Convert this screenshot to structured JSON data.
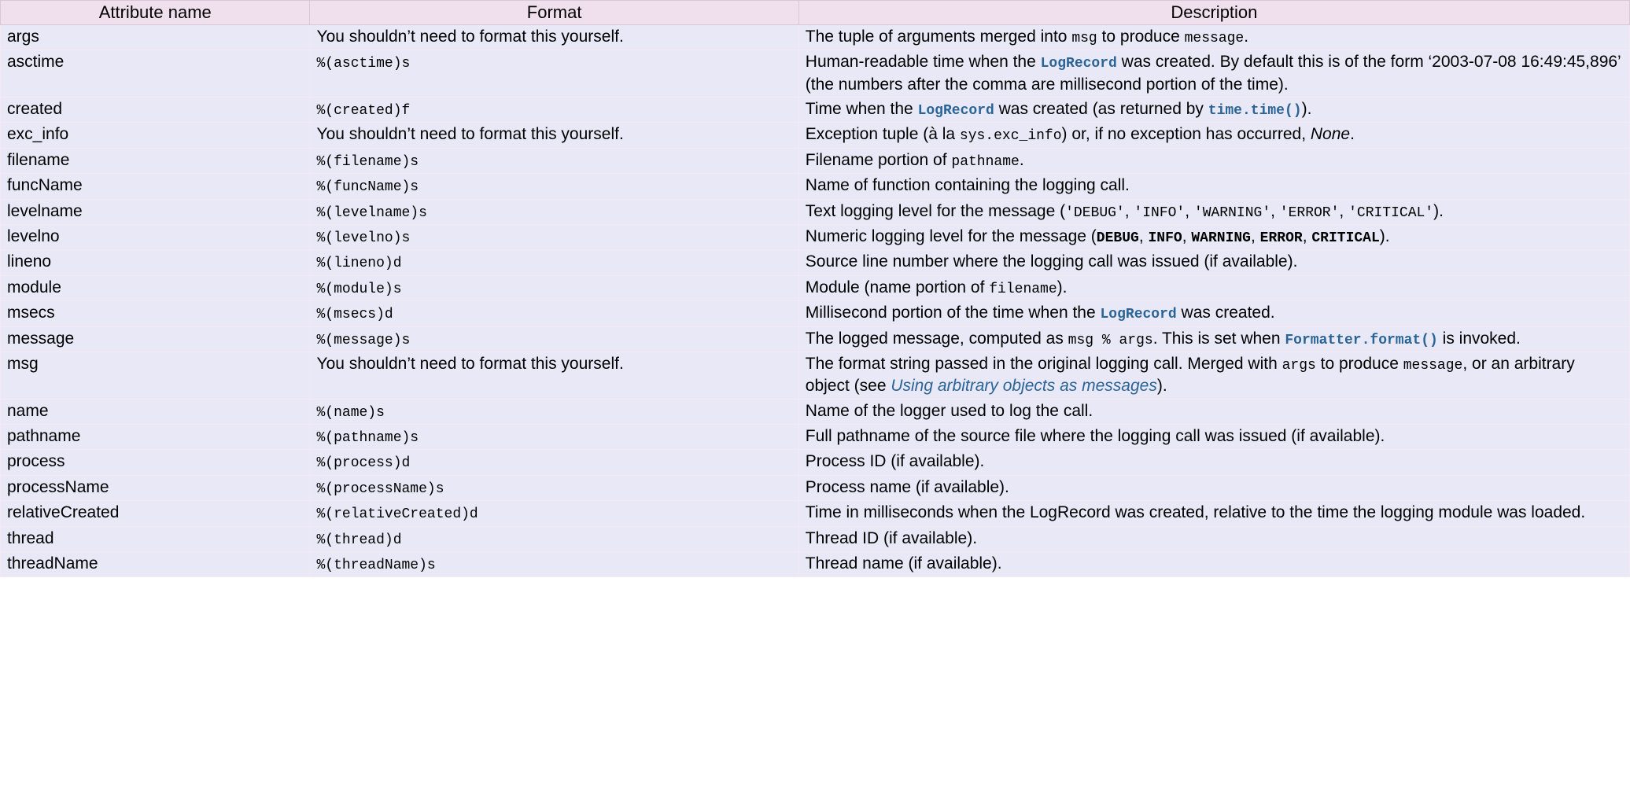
{
  "headers": {
    "name": "Attribute name",
    "format": "Format",
    "description": "Description"
  },
  "rows": [
    {
      "name": "args",
      "format": [
        {
          "t": "text",
          "v": "You shouldn’t need to format this yourself."
        }
      ],
      "desc": [
        {
          "t": "text",
          "v": "The tuple of arguments merged into "
        },
        {
          "t": "lit",
          "v": "msg"
        },
        {
          "t": "text",
          "v": " to produce "
        },
        {
          "t": "lit",
          "v": "message"
        },
        {
          "t": "text",
          "v": "."
        }
      ]
    },
    {
      "name": "asctime",
      "format": [
        {
          "t": "lit",
          "v": "%(asctime)s"
        }
      ],
      "desc": [
        {
          "t": "text",
          "v": "Human-readable time when the "
        },
        {
          "t": "ref",
          "v": "LogRecord"
        },
        {
          "t": "text",
          "v": " was created. By default this is of the form ‘2003-07-08 16:49:45,896’ (the numbers after the comma are millisecond portion of the time)."
        }
      ]
    },
    {
      "name": "created",
      "format": [
        {
          "t": "lit",
          "v": "%(created)f"
        }
      ],
      "desc": [
        {
          "t": "text",
          "v": "Time when the "
        },
        {
          "t": "ref",
          "v": "LogRecord"
        },
        {
          "t": "text",
          "v": " was created (as returned by "
        },
        {
          "t": "ref",
          "v": "time.time()"
        },
        {
          "t": "text",
          "v": ")."
        }
      ]
    },
    {
      "name": "exc_info",
      "format": [
        {
          "t": "text",
          "v": "You shouldn’t need to format this yourself."
        }
      ],
      "desc": [
        {
          "t": "text",
          "v": "Exception tuple (à la "
        },
        {
          "t": "lit",
          "v": "sys.exc_info"
        },
        {
          "t": "text",
          "v": ") or, if no exception has occurred, "
        },
        {
          "t": "italic",
          "v": "None"
        },
        {
          "t": "text",
          "v": "."
        }
      ]
    },
    {
      "name": "filename",
      "format": [
        {
          "t": "lit",
          "v": "%(filename)s"
        }
      ],
      "desc": [
        {
          "t": "text",
          "v": "Filename portion of "
        },
        {
          "t": "lit",
          "v": "pathname"
        },
        {
          "t": "text",
          "v": "."
        }
      ]
    },
    {
      "name": "funcName",
      "format": [
        {
          "t": "lit",
          "v": "%(funcName)s"
        }
      ],
      "desc": [
        {
          "t": "text",
          "v": "Name of function containing the logging call."
        }
      ]
    },
    {
      "name": "levelname",
      "format": [
        {
          "t": "lit",
          "v": "%(levelname)s"
        }
      ],
      "desc": [
        {
          "t": "text",
          "v": "Text logging level for the message ("
        },
        {
          "t": "lit",
          "v": "'DEBUG'"
        },
        {
          "t": "text",
          "v": ", "
        },
        {
          "t": "lit",
          "v": "'INFO'"
        },
        {
          "t": "text",
          "v": ", "
        },
        {
          "t": "lit",
          "v": "'WARNING'"
        },
        {
          "t": "text",
          "v": ", "
        },
        {
          "t": "lit",
          "v": "'ERROR'"
        },
        {
          "t": "text",
          "v": ", "
        },
        {
          "t": "lit",
          "v": "'CRITICAL'"
        },
        {
          "t": "text",
          "v": ")."
        }
      ]
    },
    {
      "name": "levelno",
      "format": [
        {
          "t": "lit",
          "v": "%(levelno)s"
        }
      ],
      "desc": [
        {
          "t": "text",
          "v": "Numeric logging level for the message ("
        },
        {
          "t": "bold",
          "v": "DEBUG"
        },
        {
          "t": "text",
          "v": ", "
        },
        {
          "t": "bold",
          "v": "INFO"
        },
        {
          "t": "text",
          "v": ", "
        },
        {
          "t": "bold",
          "v": "WARNING"
        },
        {
          "t": "text",
          "v": ", "
        },
        {
          "t": "bold",
          "v": "ERROR"
        },
        {
          "t": "text",
          "v": ", "
        },
        {
          "t": "bold",
          "v": "CRITICAL"
        },
        {
          "t": "text",
          "v": ")."
        }
      ]
    },
    {
      "name": "lineno",
      "format": [
        {
          "t": "lit",
          "v": "%(lineno)d"
        }
      ],
      "desc": [
        {
          "t": "text",
          "v": "Source line number where the logging call was issued (if available)."
        }
      ]
    },
    {
      "name": "module",
      "format": [
        {
          "t": "lit",
          "v": "%(module)s"
        }
      ],
      "desc": [
        {
          "t": "text",
          "v": "Module (name portion of "
        },
        {
          "t": "lit",
          "v": "filename"
        },
        {
          "t": "text",
          "v": ")."
        }
      ]
    },
    {
      "name": "msecs",
      "format": [
        {
          "t": "lit",
          "v": "%(msecs)d"
        }
      ],
      "desc": [
        {
          "t": "text",
          "v": "Millisecond portion of the time when the "
        },
        {
          "t": "ref",
          "v": "LogRecord"
        },
        {
          "t": "text",
          "v": " was created."
        }
      ]
    },
    {
      "name": "message",
      "format": [
        {
          "t": "lit",
          "v": "%(message)s"
        }
      ],
      "desc": [
        {
          "t": "text",
          "v": "The logged message, computed as "
        },
        {
          "t": "lit",
          "v": "msg % args"
        },
        {
          "t": "text",
          "v": ". This is set when "
        },
        {
          "t": "ref",
          "v": "Formatter.format()"
        },
        {
          "t": "text",
          "v": " is invoked."
        }
      ]
    },
    {
      "name": "msg",
      "format": [
        {
          "t": "text",
          "v": "You shouldn’t need to format this yourself."
        }
      ],
      "desc": [
        {
          "t": "text",
          "v": "The format string passed in the original logging call. Merged with "
        },
        {
          "t": "lit",
          "v": "args"
        },
        {
          "t": "text",
          "v": " to produce "
        },
        {
          "t": "lit",
          "v": "message"
        },
        {
          "t": "text",
          "v": ", or an arbitrary object (see "
        },
        {
          "t": "link",
          "v": "Using arbitrary objects as messages"
        },
        {
          "t": "text",
          "v": ")."
        }
      ]
    },
    {
      "name": "name",
      "format": [
        {
          "t": "lit",
          "v": "%(name)s"
        }
      ],
      "desc": [
        {
          "t": "text",
          "v": "Name of the logger used to log the call."
        }
      ]
    },
    {
      "name": "pathname",
      "format": [
        {
          "t": "lit",
          "v": "%(pathname)s"
        }
      ],
      "desc": [
        {
          "t": "text",
          "v": "Full pathname of the source file where the logging call was issued (if available)."
        }
      ]
    },
    {
      "name": "process",
      "format": [
        {
          "t": "lit",
          "v": "%(process)d"
        }
      ],
      "desc": [
        {
          "t": "text",
          "v": "Process ID (if available)."
        }
      ]
    },
    {
      "name": "processName",
      "format": [
        {
          "t": "lit",
          "v": "%(processName)s"
        }
      ],
      "desc": [
        {
          "t": "text",
          "v": "Process name (if available)."
        }
      ]
    },
    {
      "name": "relativeCreated",
      "format": [
        {
          "t": "lit",
          "v": "%(relativeCreated)d"
        }
      ],
      "desc": [
        {
          "t": "text",
          "v": "Time in milliseconds when the LogRecord was created, relative to the time the logging module was loaded."
        }
      ]
    },
    {
      "name": "thread",
      "format": [
        {
          "t": "lit",
          "v": "%(thread)d"
        }
      ],
      "desc": [
        {
          "t": "text",
          "v": "Thread ID (if available)."
        }
      ]
    },
    {
      "name": "threadName",
      "format": [
        {
          "t": "lit",
          "v": "%(threadName)s"
        }
      ],
      "desc": [
        {
          "t": "text",
          "v": "Thread name (if available)."
        }
      ]
    }
  ]
}
